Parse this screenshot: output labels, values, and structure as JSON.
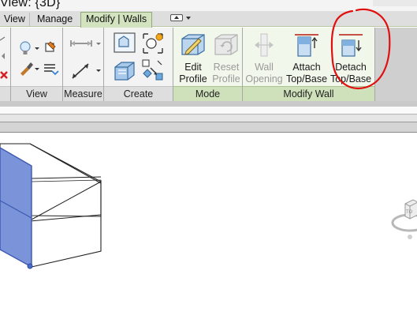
{
  "window": {
    "title": "View: {3D}"
  },
  "tabs": [
    {
      "label": "View"
    },
    {
      "label": "Manage"
    },
    {
      "label": "Modify | Walls",
      "active": true
    }
  ],
  "ribbon": {
    "panels": {
      "view": "View",
      "measure": "Measure",
      "create": "Create",
      "mode": "Mode",
      "modify_wall": "Modify Wall"
    },
    "buttons": {
      "edit_profile": "Edit Profile",
      "reset_profile": "Reset Profile",
      "wall_opening": "Wall Opening",
      "attach_top_base": "Attach Top/Base",
      "detach_top_base": "Detach Top/Base"
    },
    "disabled": [
      "reset_profile",
      "wall_opening"
    ]
  },
  "colors": {
    "active_tab": "#d3e3c0",
    "modify_panel": "#cfe1bb",
    "annotation": "#e01010",
    "wall_selected": "#7b93d9"
  },
  "icons": [
    "lightbulb-icon",
    "paint-brush-icon",
    "paint-icon",
    "linework-icon",
    "delete-x-icon",
    "dimension-icon",
    "measure-icon",
    "create-similar-icon",
    "create-group-icon",
    "create-parts-icon",
    "create-assembly-icon",
    "edit-profile-icon",
    "reset-profile-icon",
    "wall-opening-icon",
    "attach-top-base-icon",
    "detach-top-base-icon",
    "quick-access-icon",
    "viewcube-icon"
  ]
}
